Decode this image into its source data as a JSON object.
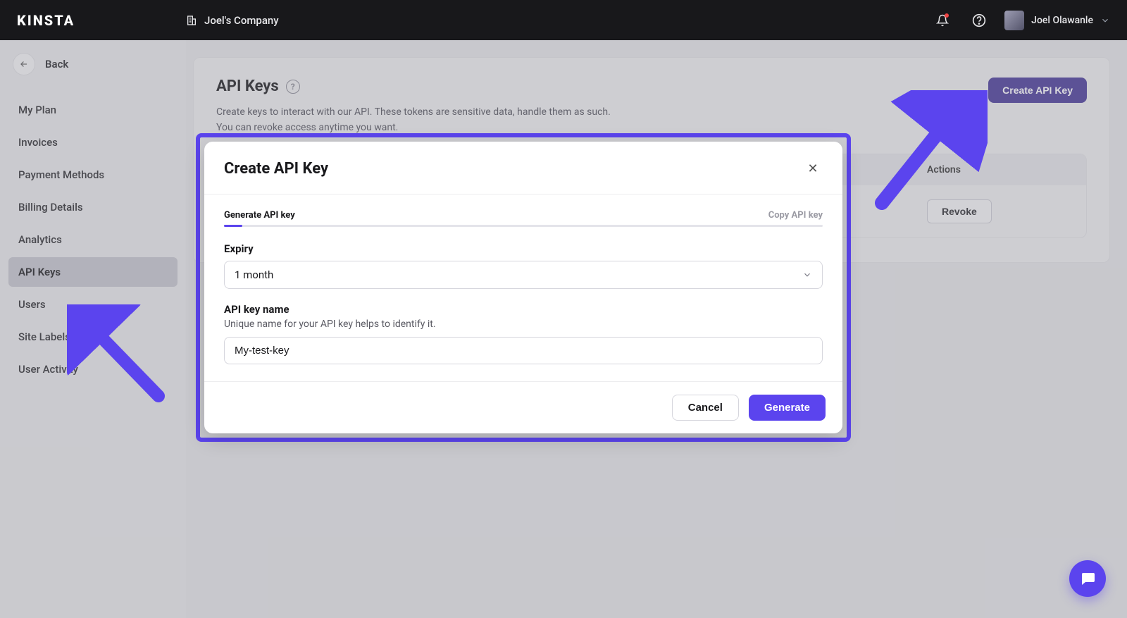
{
  "header": {
    "logo": "KINSTA",
    "company": "Joel's Company",
    "user": "Joel Olawanle"
  },
  "sidebar": {
    "back": "Back",
    "items": [
      {
        "label": "My Plan"
      },
      {
        "label": "Invoices"
      },
      {
        "label": "Payment Methods"
      },
      {
        "label": "Billing Details"
      },
      {
        "label": "Analytics"
      },
      {
        "label": "API Keys",
        "active": true
      },
      {
        "label": "Users"
      },
      {
        "label": "Site Labels"
      },
      {
        "label": "User Activity"
      }
    ]
  },
  "page": {
    "title": "API Keys",
    "description_line1": "Create keys to interact with our API. These tokens are sensitive data, handle them as such.",
    "description_line2": "You can revoke access anytime you want.",
    "create_button": "Create API Key"
  },
  "table": {
    "headers": {
      "actions": "Actions"
    },
    "row": {
      "revoke": "Revoke"
    }
  },
  "modal": {
    "title": "Create API Key",
    "step_active": "Generate API key",
    "step_inactive": "Copy API key",
    "expiry_label": "Expiry",
    "expiry_value": "1 month",
    "name_label": "API key name",
    "name_help": "Unique name for your API key helps to identify it.",
    "name_value": "My-test-key",
    "cancel": "Cancel",
    "generate": "Generate"
  },
  "colors": {
    "accent": "#5b44ee",
    "primary_btn": "#463797"
  }
}
